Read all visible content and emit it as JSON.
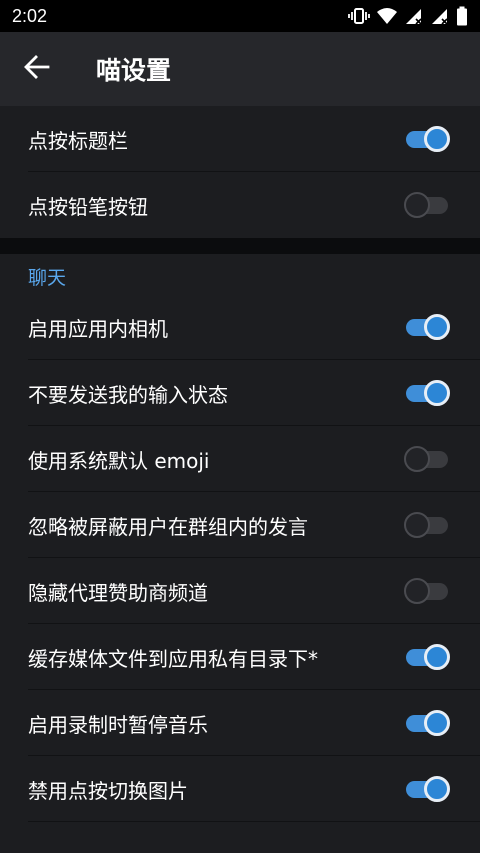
{
  "status_bar": {
    "time": "2:02"
  },
  "toolbar": {
    "back_icon": "arrow-left-icon",
    "title": "喵设置"
  },
  "top_group": {
    "items": [
      {
        "label": "点按标题栏",
        "enabled": true
      },
      {
        "label": "点按铅笔按钮",
        "enabled": false
      }
    ]
  },
  "chat_section": {
    "title": "聊天",
    "items": [
      {
        "label": "启用应用内相机",
        "enabled": true
      },
      {
        "label": "不要发送我的输入状态",
        "enabled": true
      },
      {
        "label": "使用系统默认 emoji",
        "enabled": false
      },
      {
        "label": "忽略被屏蔽用户在群组内的发言",
        "enabled": false
      },
      {
        "label": "隐藏代理赞助商频道",
        "enabled": false
      },
      {
        "label": "缓存媒体文件到应用私有目录下*",
        "enabled": true
      },
      {
        "label": "启用录制时暂停音乐",
        "enabled": true
      },
      {
        "label": "禁用点按切换图片",
        "enabled": true
      }
    ]
  },
  "colors": {
    "accent": "#3f8ed8",
    "section_title": "#5aa7ec",
    "background": "#1c1d20",
    "toolbar": "#26272b"
  }
}
